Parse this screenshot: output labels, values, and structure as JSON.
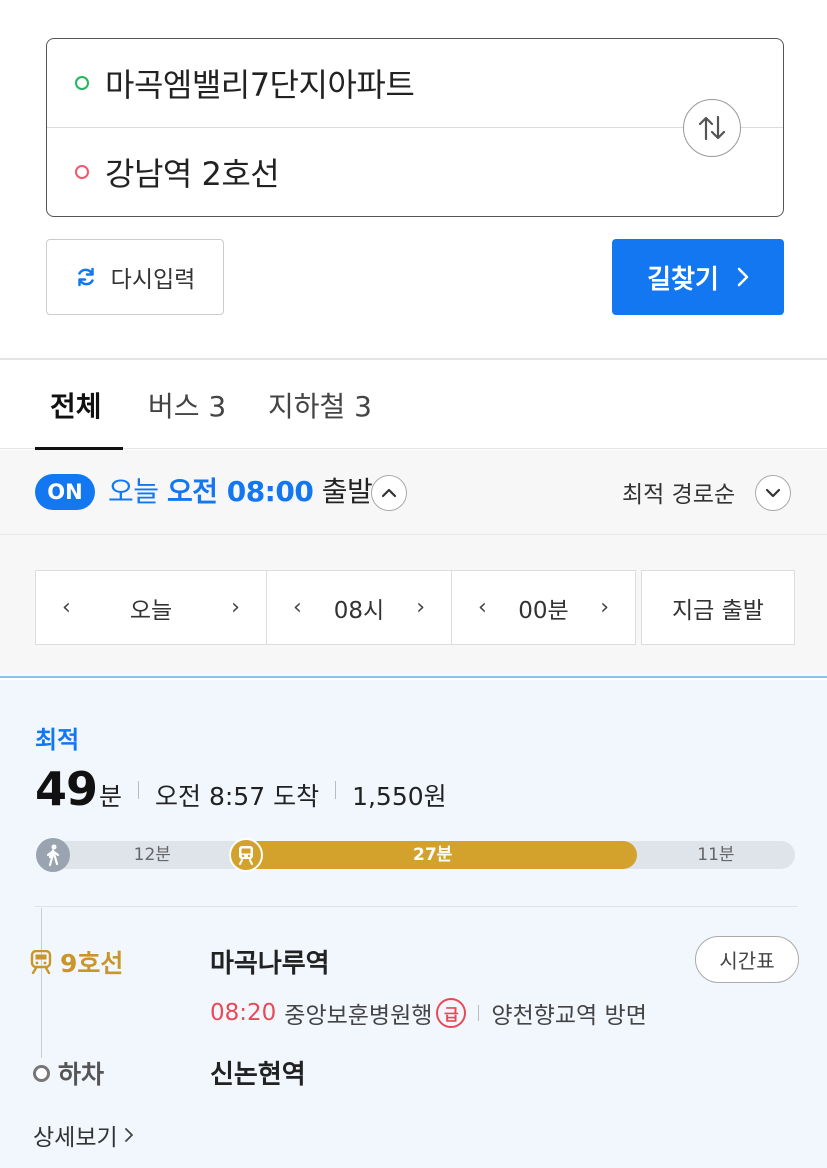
{
  "search": {
    "origin": "마곡엠밸리7단지아파트",
    "destination": "강남역 2호선",
    "swap_icon": "swap-vertical-icon",
    "reset_label": "다시입력",
    "find_label": "길찾기"
  },
  "tabs": [
    {
      "label": "전체",
      "active": true
    },
    {
      "label": "버스 3",
      "active": false
    },
    {
      "label": "지하철 3",
      "active": false
    }
  ],
  "departure": {
    "badge": "ON",
    "day": "오늘",
    "ampm_time": "오전 08:00",
    "suffix": "출발",
    "sort_label": "최적 경로순",
    "day_select": "오늘",
    "hour_select": "08시",
    "minute_select": "00분",
    "now_label": "지금 출발"
  },
  "route": {
    "badge": "최적",
    "minutes": "49",
    "minutes_unit": "분",
    "arrival": "오전 8:57 도착",
    "fare": "1,550원",
    "segments": [
      {
        "mode": "walk",
        "label": "12분",
        "minutes": 12
      },
      {
        "mode": "subway",
        "label": "27분",
        "minutes": 27
      },
      {
        "mode": "walk",
        "label": "11분",
        "minutes": 11
      }
    ],
    "line_label": "9호선",
    "board_station": "마곡나루역",
    "timetable_label": "시간표",
    "train_time": "08:20",
    "train_dest": "중앙보훈병원행",
    "express_badge": "급",
    "direction": "양천향교역 방면",
    "alight_label": "하차",
    "alight_station": "신논현역",
    "detail_label": "상세보기"
  },
  "colors": {
    "accent": "#1377f2",
    "subway_line9": "#d2a22c",
    "express": "#e84a55"
  }
}
